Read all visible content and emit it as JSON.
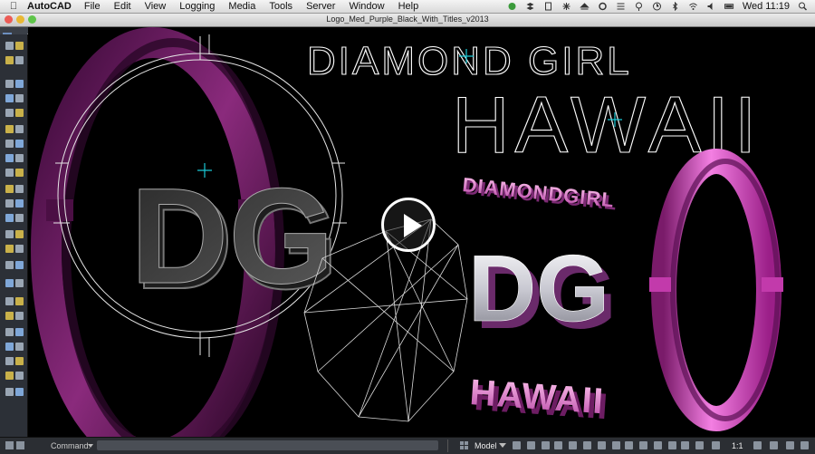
{
  "menubar": {
    "app_name": "AutoCAD",
    "items": [
      "File",
      "Edit",
      "View",
      "Logging",
      "Media",
      "Tools",
      "Server",
      "Window",
      "Help"
    ],
    "clock": "Wed 11:19",
    "icons": [
      "apple-icon",
      "sync-icon",
      "dropbox-icon",
      "clipboard-icon",
      "bluetooth-icon",
      "eject-icon",
      "refresh-icon",
      "list-icon",
      "pin-icon",
      "clock-icon",
      "bluetooth-icon",
      "wifi-icon",
      "volume-icon",
      "battery-icon",
      "search-icon"
    ]
  },
  "window": {
    "title": "Logo_Med_Purple_Black_With_Titles_v2013"
  },
  "drawing": {
    "wire_title_top": "DIAMOND GIRL",
    "wire_title_bottom": "HAWAII",
    "logo_letters": "DG",
    "solid_title_top": "DIAMONDGIRL",
    "solid_title_bottom": "HAWAII",
    "colors": {
      "purple": "#7a1a6a",
      "magenta": "#d633c4",
      "pink": "#f08ad8",
      "crosshair": "#19c9d6"
    }
  },
  "video": {
    "play_icon": "play-icon"
  },
  "statusbar": {
    "command_label": "Command:",
    "model_label": "Model",
    "scale_label": "1:1"
  }
}
